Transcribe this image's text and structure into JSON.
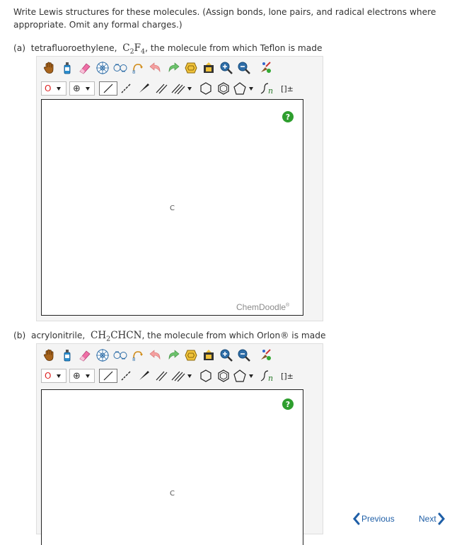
{
  "prompt": "Write Lewis structures for these molecules. (Assign bonds, lone pairs, and radical electrons where appropriate. Omit any formal charges.)",
  "questions": [
    {
      "label": "(a)",
      "name": "tetrafluoroethylene,",
      "formula_main": "C",
      "sub1": "2",
      "formula_mid": "F",
      "sub2": "4",
      "suffix": ", the molecule from which Teflon is made",
      "canvas_atom": "C",
      "brand": "ChemDoodle",
      "brand_mark": "®",
      "help": "?"
    },
    {
      "label": "(b)",
      "name": "acrylonitrile,",
      "formula_main": "CH",
      "sub1": "2",
      "formula_mid": "CHCN",
      "suffix": ", the molecule from which Orlon® is made",
      "canvas_atom": "C",
      "help": "?"
    }
  ],
  "toolbar": {
    "element": "O",
    "charge_symbol": "⊕",
    "sgroup": "n",
    "bracket": "[]±"
  },
  "nav": {
    "previous": "Previous",
    "next": "Next"
  }
}
